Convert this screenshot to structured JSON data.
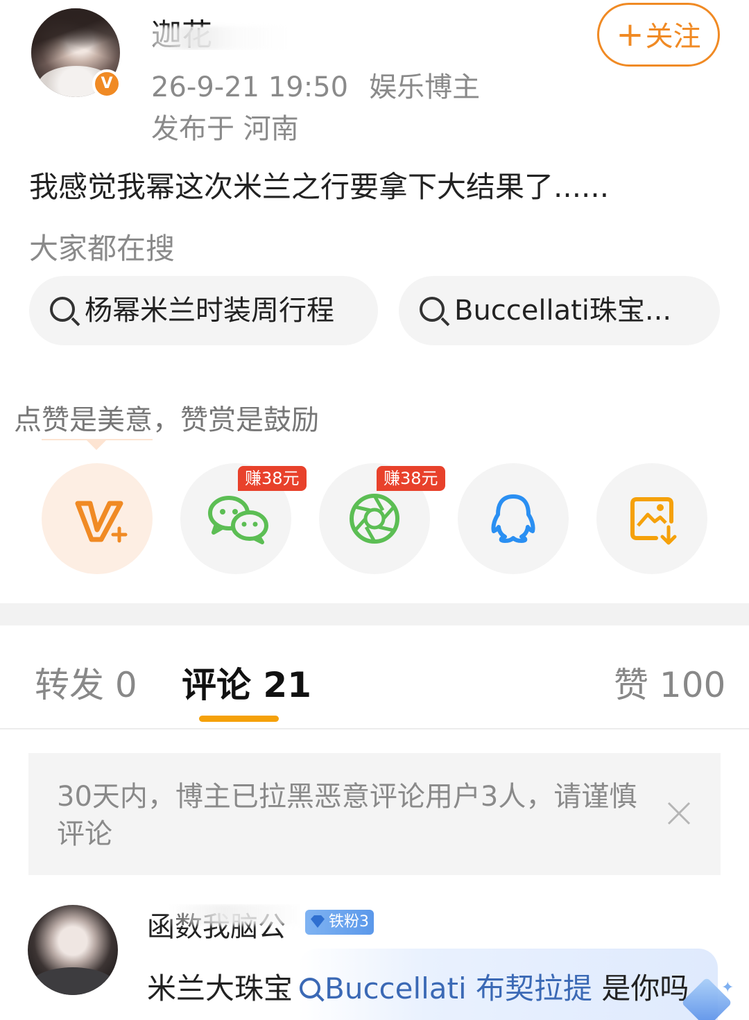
{
  "post": {
    "author_name": "迦花",
    "timestamp": "26-9-21 19:50",
    "author_tag": "娱乐博主",
    "location": "发布于 河南",
    "follow_button": "关注",
    "follow_plus": "+",
    "verified_badge": "V",
    "text": "我感觉我幂这次米兰之行要拿下大结果了......"
  },
  "search": {
    "title": "大家都在搜",
    "chips": [
      {
        "label": "杨幂米兰时装周行程",
        "icon": "search-icon"
      },
      {
        "label": "Buccellati珠宝...",
        "icon": "search-icon"
      }
    ]
  },
  "reward": {
    "text": "点赞是美意，赞赏是鼓励"
  },
  "share": {
    "items": [
      {
        "icon": "v-plus-icon",
        "color": "#f08a24"
      },
      {
        "icon": "wechat-icon",
        "color": "#5cbe54",
        "badge": "赚38元"
      },
      {
        "icon": "moments-icon",
        "color": "#5cbe54",
        "badge": "赚38元"
      },
      {
        "icon": "qq-icon",
        "color": "#2a8ff2"
      },
      {
        "icon": "save-image-icon",
        "color": "#f5a10a"
      }
    ]
  },
  "tabs": [
    {
      "label": "转发 0",
      "active": false
    },
    {
      "label": "评论 21",
      "active": true
    },
    {
      "label": "赞 100",
      "active": false
    }
  ],
  "notice": {
    "text": "30天内，博主已拉黑恶意评论用户3人，请谨慎评论",
    "close_icon": "close-icon"
  },
  "comment": {
    "username": "函数我脑公",
    "fan_badge": "铁粉3",
    "text_prefix": "米兰大珠宝",
    "link_text": "Buccellati 布契拉提",
    "text_suffix": "是你吗"
  },
  "colors": {
    "accent_orange": "#f08a24",
    "tab_underline": "#f5a10a",
    "earn_badge_red": "#e8412b",
    "link_blue": "#3b69b5"
  }
}
